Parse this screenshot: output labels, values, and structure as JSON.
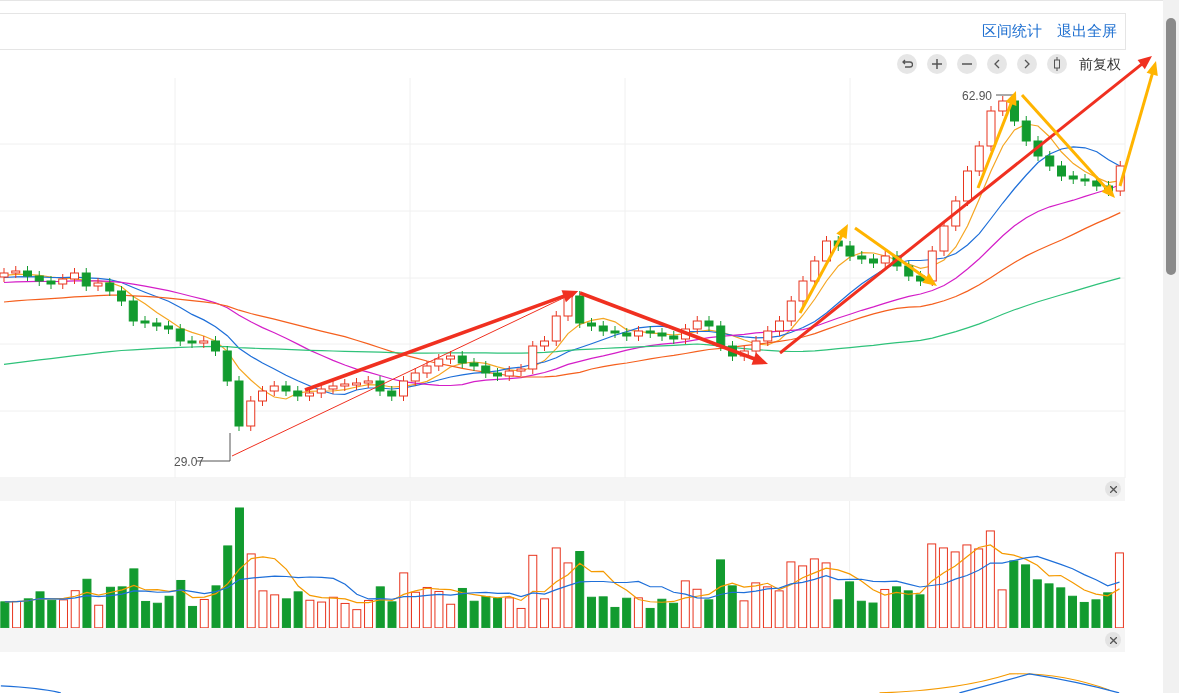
{
  "header_links": [
    {
      "label": "区间统计"
    },
    {
      "label": "退出全屏"
    }
  ],
  "toolbar": {
    "adjust_mode": "前复权"
  },
  "price_chart": {
    "low_label": "29.07",
    "high_label": "62.90"
  }
}
